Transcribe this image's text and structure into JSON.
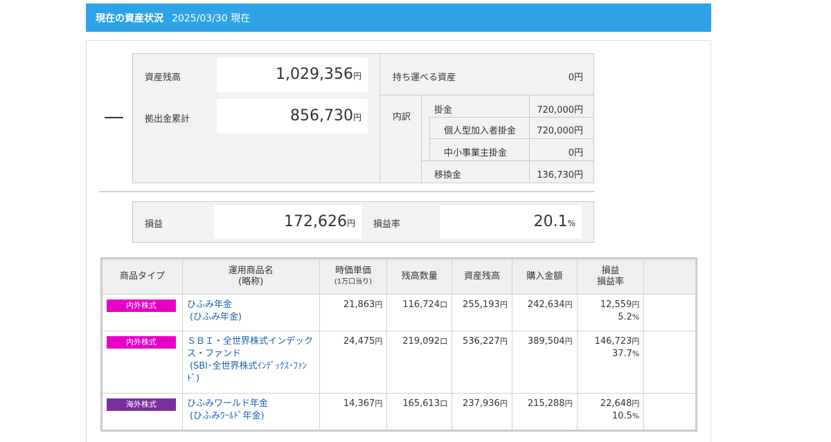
{
  "header": {
    "title": "現在の資産状況",
    "date": "2025/03/30 現在"
  },
  "summary": {
    "asset_balance_label": "資産残高",
    "asset_balance_value": "1,029,356",
    "contribution_total_label": "拠出金累計",
    "contribution_total_value": "856,730",
    "yen": "円",
    "portable_label": "持ち運べる資産",
    "portable_value": "0円",
    "breakdown_label": "内訳",
    "breakdown": {
      "kakekin_label": "掛金",
      "kakekin_value": "720,000円",
      "individual_label": "個人型加入者掛金",
      "individual_value": "720,000円",
      "sme_label": "中小事業主掛金",
      "sme_value": "0円",
      "transfer_label": "移換金",
      "transfer_value": "136,730円"
    }
  },
  "pnl": {
    "label": "損益",
    "value": "172,626",
    "yen": "円",
    "rate_label": "損益率",
    "rate_value": "20.1",
    "pct": "%"
  },
  "table": {
    "headers": {
      "type": "商品タイプ",
      "name_1": "運用商品名",
      "name_2": "(略称)",
      "price_1": "時価単価",
      "price_2": "(1万口当り)",
      "units": "残高数量",
      "balance": "資産残高",
      "cost": "購入金額",
      "pl_1": "損益",
      "pl_2": "損益率"
    },
    "rows": [
      {
        "type": "内外株式",
        "type_color": "#e600c8",
        "name": "ひふみ年金",
        "short": "(ひふみ年金)",
        "price": "21,863",
        "units": "116,724",
        "balance": "255,193",
        "cost": "242,634",
        "pl": "12,559",
        "rate": "5.2"
      },
      {
        "type": "内外株式",
        "type_color": "#e600c8",
        "name": "ＳＢＩ・全世界株式インデックス・ファンド",
        "short": "(SBI･全世界株式ｲﾝﾃﾞｯｸｽ･ﾌｧﾝﾄﾞ)",
        "price": "24,475",
        "units": "219,092",
        "balance": "536,227",
        "cost": "389,504",
        "pl": "146,723",
        "rate": "37.7"
      },
      {
        "type": "海外株式",
        "type_color": "#7a2f9c",
        "name": "ひふみワールド年金",
        "short": "(ひふみﾜｰﾙﾄﾞ年金)",
        "price": "14,367",
        "units": "165,613",
        "balance": "237,936",
        "cost": "215,288",
        "pl": "22,648",
        "rate": "10.5"
      }
    ],
    "yen": "円",
    "kuchi": "口",
    "pct": "%"
  }
}
